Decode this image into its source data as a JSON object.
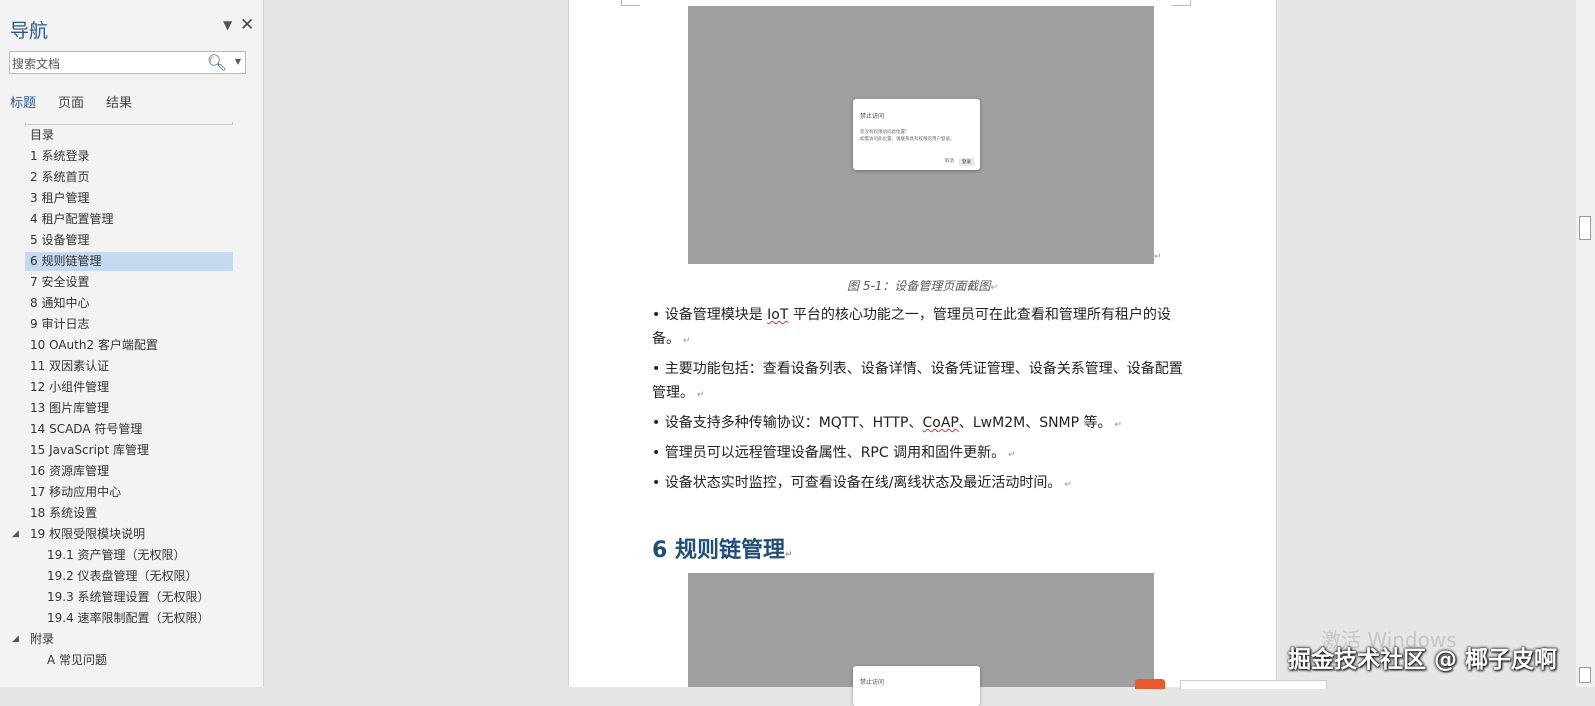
{
  "nav": {
    "title": "导航",
    "search_placeholder": "搜索文档",
    "tabs": [
      "标题",
      "页面",
      "结果"
    ],
    "items": [
      {
        "label": "目录",
        "level": 1
      },
      {
        "label": "1 系统登录",
        "level": 1
      },
      {
        "label": "2 系统首页",
        "level": 1
      },
      {
        "label": "3 租户管理",
        "level": 1
      },
      {
        "label": "4 租户配置管理",
        "level": 1
      },
      {
        "label": "5 设备管理",
        "level": 1
      },
      {
        "label": "6 规则链管理",
        "level": 1,
        "selected": true
      },
      {
        "label": "7 安全设置",
        "level": 1
      },
      {
        "label": "8 通知中心",
        "level": 1
      },
      {
        "label": "9 审计日志",
        "level": 1
      },
      {
        "label": "10 OAuth2 客户端配置",
        "level": 1
      },
      {
        "label": "11 双因素认证",
        "level": 1
      },
      {
        "label": "12 小组件管理",
        "level": 1
      },
      {
        "label": "13 图片库管理",
        "level": 1
      },
      {
        "label": "14 SCADA 符号管理",
        "level": 1
      },
      {
        "label": "15 JavaScript 库管理",
        "level": 1
      },
      {
        "label": "16 资源库管理",
        "level": 1
      },
      {
        "label": "17 移动应用中心",
        "level": 1
      },
      {
        "label": "18 系统设置",
        "level": 1
      },
      {
        "label": "19 权限受限模块说明",
        "level": 1,
        "expanded": true
      },
      {
        "label": "19.1 资产管理（无权限）",
        "level": 2
      },
      {
        "label": "19.2 仪表盘管理（无权限）",
        "level": 2
      },
      {
        "label": "19.3 系统管理设置（无权限）",
        "level": 2
      },
      {
        "label": "19.4 速率限制配置（无权限）",
        "level": 2
      },
      {
        "label": "附录",
        "level": 1,
        "expanded": true
      },
      {
        "label": "A 常见问题",
        "level": 2
      }
    ]
  },
  "document": {
    "dialog": {
      "title": "禁止访问",
      "body_line1": "您没有权限访问此位置!",
      "body_line2": "如需访问此位置，请联系具有权限的用户登录。",
      "cancel": "取消",
      "ok": "登录"
    },
    "figure_caption": "图 5-1：设备管理页面截图",
    "bullets": [
      {
        "before": "• 设备管理模块是 ",
        "flag": "IoT",
        "after": " 平台的核心功能之一，管理员可在此查看和管理所有租户的设备。"
      },
      {
        "before": "• 主要功能包括：查看设备列表、设备详情、设备凭证管理、设备关系管理、设备配置管理。",
        "flag": "",
        "after": ""
      },
      {
        "before": "• 设备支持多种传输协议：MQTT、HTTP、",
        "flag": "CoAP",
        "after": "、LwM2M、SNMP 等。"
      },
      {
        "before": "• 管理员可以远程管理设备属性、RPC 调用和固件更新。",
        "flag": "",
        "after": ""
      },
      {
        "before": "• 设备状态实时监控，可查看设备在线/离线状态及最近活动时间。",
        "flag": "",
        "after": ""
      }
    ],
    "section_heading": "6 规则链管理",
    "dialog2_title": "禁止访问"
  },
  "overlay": {
    "activate_windows": "激活 Windows",
    "watermark": "掘金技术社区 @ 椰子皮啊"
  }
}
